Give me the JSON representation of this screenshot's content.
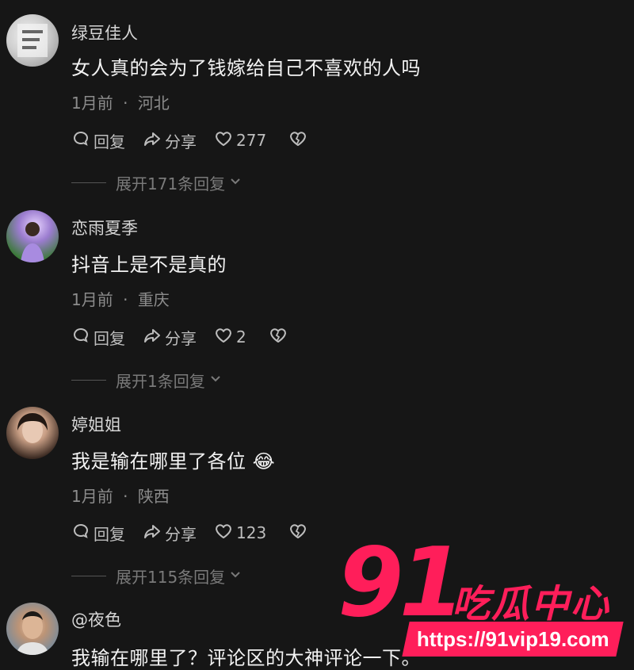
{
  "comments": [
    {
      "username": "绿豆佳人",
      "text": "女人真的会为了钱嫁给自己不喜欢的人吗",
      "time": "1月前",
      "location": "河北",
      "reply_label": "回复",
      "share_label": "分享",
      "likes": "277",
      "expand_label": "展开171条回复"
    },
    {
      "username": "恋雨夏季",
      "text": "抖音上是不是真的",
      "time": "1月前",
      "location": "重庆",
      "reply_label": "回复",
      "share_label": "分享",
      "likes": "2",
      "expand_label": "展开1条回复"
    },
    {
      "username": "婷姐姐",
      "text": "我是输在哪里了各位",
      "emoji": "😂",
      "time": "1月前",
      "location": "陕西",
      "reply_label": "回复",
      "share_label": "分享",
      "likes": "123",
      "expand_label": "展开115条回复"
    },
    {
      "username": "@夜色",
      "text": "我输在哪里了？评论区的大神评论一下。"
    }
  ],
  "separator": "·",
  "icons": [
    "reply-icon",
    "share-icon",
    "heart-icon",
    "dislike-heart-icon",
    "chevron-down-icon"
  ],
  "watermark": {
    "number": "91",
    "title": "吃瓜中心",
    "url": "https://91vip19.com",
    "color": "#ff1e5a"
  }
}
